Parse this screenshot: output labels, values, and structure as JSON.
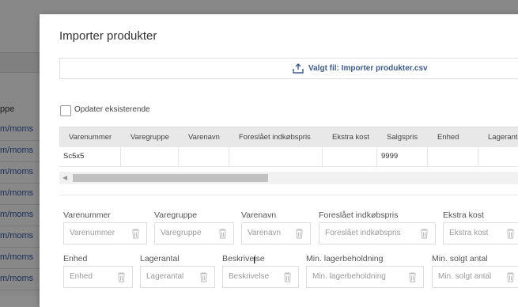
{
  "background": {
    "header": "ppe",
    "rows": [
      "m/moms",
      "m/moms",
      "m/moms",
      "m/moms",
      "m/moms",
      "m/moms",
      "m/moms",
      "m/moms"
    ]
  },
  "modal": {
    "title": "Importer produkter",
    "upload_label": "Valgt fil: Importer produkter.csv",
    "update_existing_label": "Opdater eksisterende"
  },
  "preview_table": {
    "columns": [
      "Varenummer",
      "Varegruppe",
      "Varenavn",
      "Foreslået indkøbspris",
      "Ekstra kost",
      "Salgspris",
      "Enhed",
      "Lagerantal"
    ],
    "row": [
      "Sc5x5",
      "",
      "",
      "",
      "",
      "9999",
      "",
      ""
    ]
  },
  "mapping": {
    "row1": [
      {
        "label": "Varenummer",
        "placeholder": "Varenummer"
      },
      {
        "label": "Varegruppe",
        "placeholder": "Varegruppe"
      },
      {
        "label": "Varenavn",
        "placeholder": "Varenavn"
      },
      {
        "label": "Foreslået indkøbspris",
        "placeholder": "Foreslået indkøbspris"
      },
      {
        "label": "Ekstra kost",
        "placeholder": "Ekstra kost"
      }
    ],
    "row2": [
      {
        "label": "Enhed",
        "placeholder": "Enhed"
      },
      {
        "label": "Lagerantal",
        "placeholder": "Lagerantal"
      },
      {
        "label": "Beskrivelse",
        "placeholder": "Beskrivelse"
      },
      {
        "label": "Min. lagerbeholdning",
        "placeholder": "Min. lagerbeholdning"
      },
      {
        "label": "Min. solgt antal",
        "placeholder": "Min. solgt antal"
      }
    ]
  },
  "colors": {
    "accent": "#3d5a8c",
    "link": "#2f55a4"
  }
}
